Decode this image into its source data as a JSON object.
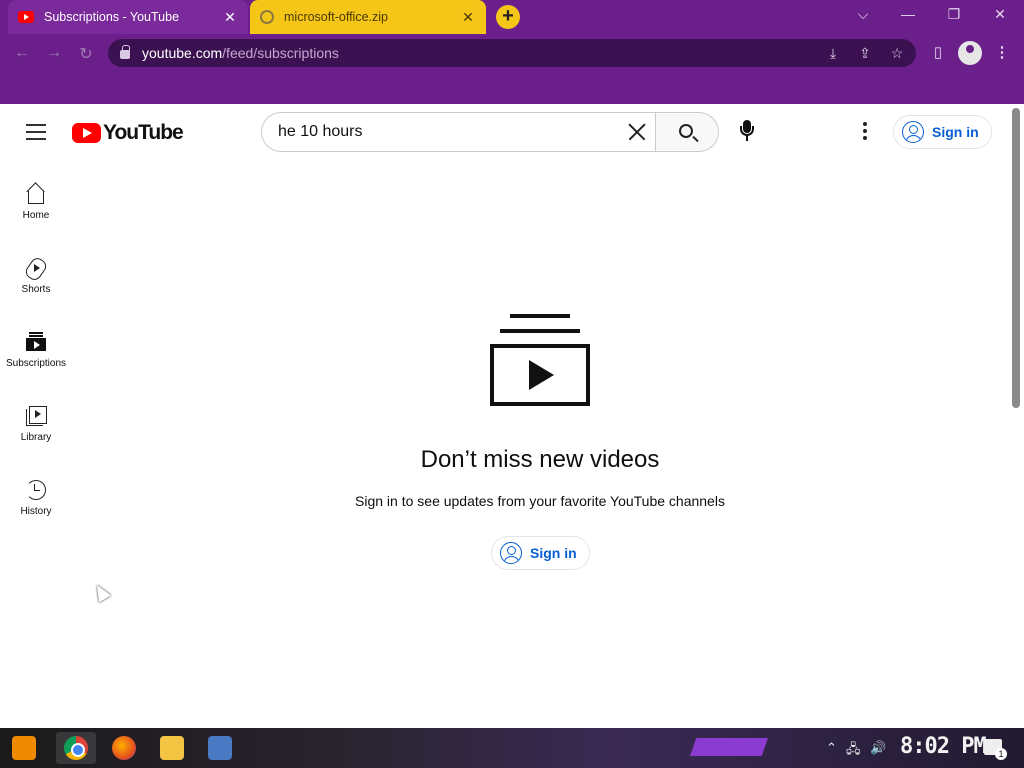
{
  "browser": {
    "tabs": [
      {
        "title": "Subscriptions - YouTube",
        "close": "✕"
      },
      {
        "title": "microsoft-office.zip",
        "close": "✕"
      }
    ],
    "new_tab": "+",
    "window_controls": {
      "dropdown": "⌵",
      "minimize": "—",
      "restore": "❐",
      "close": "✕"
    },
    "url_host": "youtube.com",
    "url_path": "/feed/subscriptions",
    "nav": {
      "back": "←",
      "forward": "→",
      "reload": "↻"
    },
    "omni_icons": {
      "install": "⤓",
      "share": "⇪",
      "bookmark": "☆"
    },
    "sidepanel": "▯",
    "accent_color": "#6b1f8a"
  },
  "youtube": {
    "logo_text": "YouTube",
    "search": {
      "value": "he 10 hours"
    },
    "signin_label": "Sign in",
    "sidebar": [
      {
        "id": "home",
        "label": "Home",
        "icon": "home-icon"
      },
      {
        "id": "shorts",
        "label": "Shorts",
        "icon": "shorts-icon"
      },
      {
        "id": "subscriptions",
        "label": "Subscriptions",
        "icon": "subscriptions-icon"
      },
      {
        "id": "library",
        "label": "Library",
        "icon": "library-icon"
      },
      {
        "id": "history",
        "label": "History",
        "icon": "history-icon"
      }
    ],
    "empty_state": {
      "headline": "Don’t miss new videos",
      "subline": "Sign in to see updates from your favorite YouTube channels",
      "button": "Sign in"
    },
    "link_color": "#065fd4"
  },
  "taskbar": {
    "clock": "8:02 PM",
    "tray": {
      "chevron": "⌃",
      "network": "🖧",
      "volume": "🔊"
    },
    "notification_count": "1"
  }
}
